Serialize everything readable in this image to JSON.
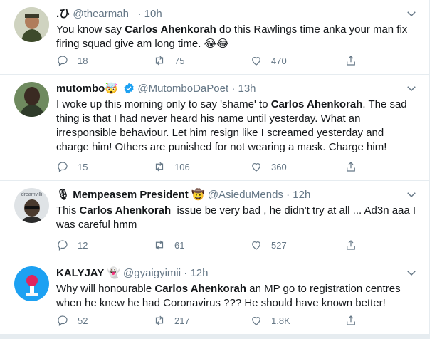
{
  "tweets": [
    {
      "display_name": ".ひ",
      "handle": "@thearmah_",
      "time": "10h",
      "text_parts": [
        "You know say ",
        "Carlos Ahenkorah",
        " do this Rawlings time anka your man fix firing squad give am long time. 😂😂"
      ],
      "replies": "18",
      "retweets": "75",
      "likes": "470"
    },
    {
      "display_name": "mutombo🤯",
      "verified": true,
      "handle": "@MutomboDaPoet",
      "time": "13h",
      "text_parts": [
        "I woke up this morning only to say 'shame' to ",
        "Carlos Ahenkorah",
        ". The sad thing is that I had never heard his name until yesterday. What an irresponsible behaviour. Let him resign like I screamed yesterday and charge him! Others are punished for not wearing a mask. Charge him!"
      ],
      "replies": "15",
      "retweets": "106",
      "likes": "360"
    },
    {
      "display_name_prefix": "🎙",
      "display_name": "Mempeasem President 🤠",
      "handle": "@AsieduMends",
      "time": "12h",
      "avatar_text": "dreamvilli",
      "text_parts": [
        "This ",
        "Carlos Ahenkorah",
        "  issue be very bad , he didn't try at all ... Ad3n aaa I was careful hmm"
      ],
      "replies": "12",
      "retweets": "61",
      "likes": "527"
    },
    {
      "display_name": "KALYJAY 👻",
      "handle": "@gyaigyimii",
      "time": "12h",
      "text_parts": [
        "Why will honourable ",
        "Carlos Ahenkorah",
        " an MP go to registration centres when he knew he had Coronavirus ??? He should have known better!"
      ],
      "replies": "52",
      "retweets": "217",
      "likes": "1.8K"
    }
  ],
  "separator": "·",
  "colors": {
    "text": "#14171a",
    "secondary": "#657786",
    "border": "#e6ecf0",
    "verified": "#1da1f2"
  },
  "icons": [
    "reply-icon",
    "retweet-icon",
    "like-icon",
    "share-icon",
    "chevron-down-icon",
    "verified-badge-icon"
  ]
}
